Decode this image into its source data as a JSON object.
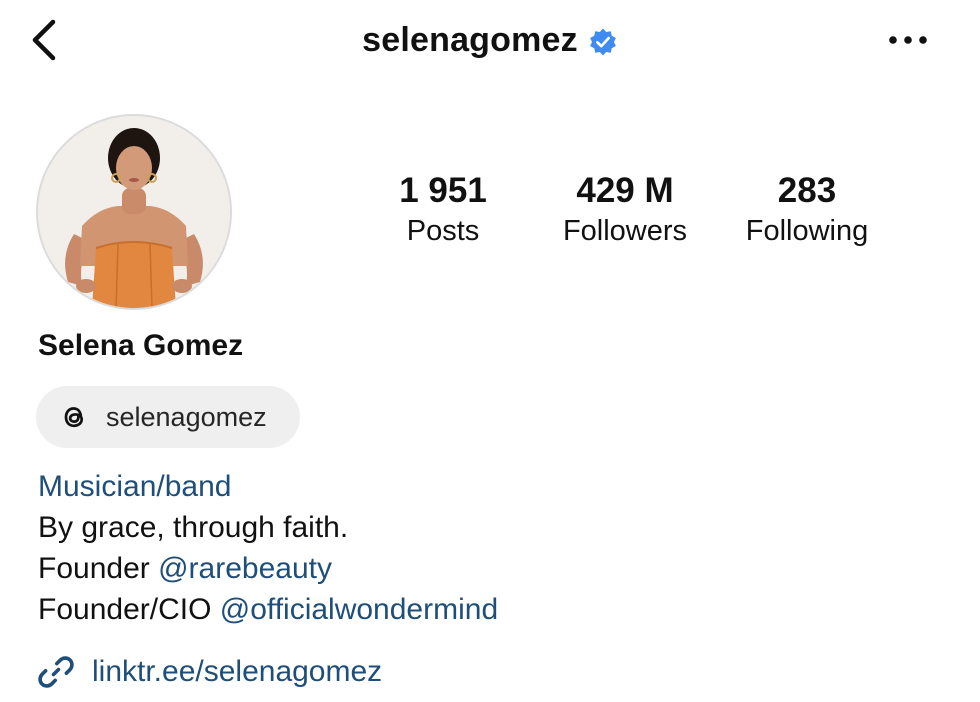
{
  "header": {
    "username": "selenagomez",
    "verified": true,
    "back_icon": "chevron-left-icon",
    "more_icon": "ellipsis-horizontal-icon",
    "verified_color": "#3f8bf0"
  },
  "profile": {
    "avatar": "profile-photo",
    "full_name": "Selena Gomez",
    "stats": {
      "posts": {
        "value": "1 951",
        "label": "Posts"
      },
      "followers": {
        "value": "429 M",
        "label": "Followers"
      },
      "following": {
        "value": "283",
        "label": "Following"
      }
    },
    "threads": {
      "icon": "threads-icon",
      "handle": "selenagomez"
    },
    "bio": {
      "category": "Musician/band",
      "line1": "By grace, through faith.",
      "line2_prefix": "Founder",
      "line2_mention": "@rarebeauty",
      "line3_prefix": "Founder/CIO",
      "line3_mention": "@officialwondermind"
    },
    "external_link": {
      "icon": "link-icon",
      "text": "linktr.ee/selenagomez"
    }
  },
  "colors": {
    "link": "#1f4e79",
    "pill_background": "#efefef",
    "verified": "#3f8bf0"
  }
}
